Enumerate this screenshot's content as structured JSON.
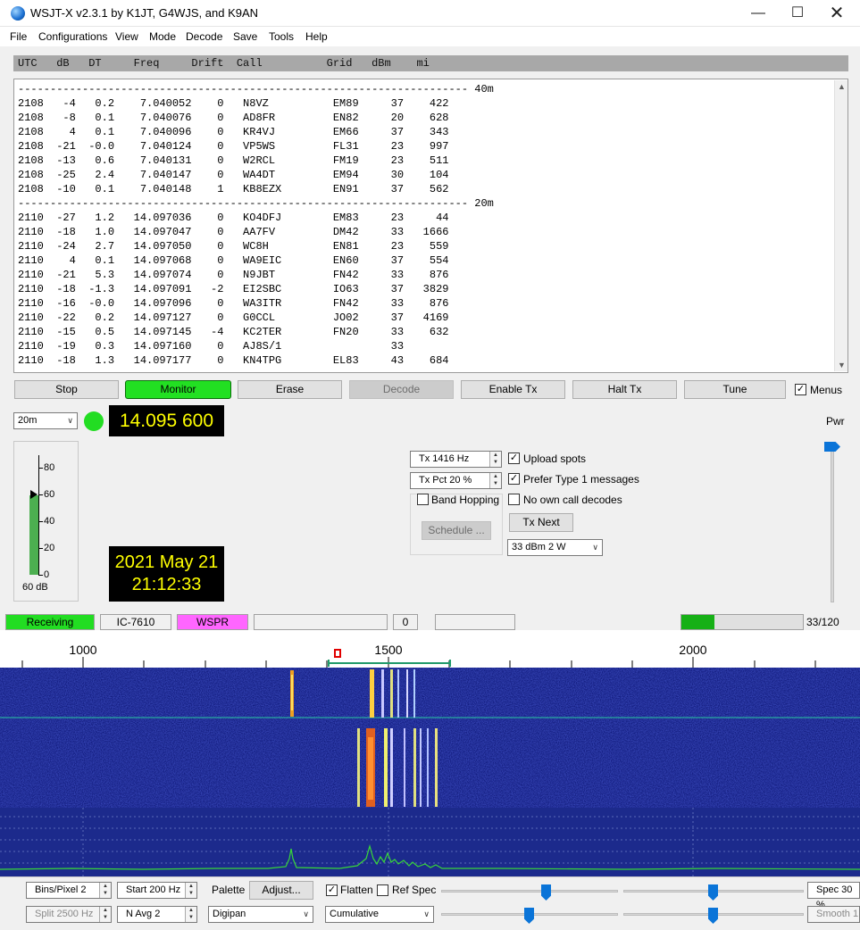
{
  "window": {
    "title": "WSJT-X  v2.3.1   by K1JT, G4WJS, and K9AN"
  },
  "menu": [
    "File",
    "Configurations",
    "View",
    "Mode",
    "Decode",
    "Save",
    "Tools",
    "Help"
  ],
  "table": {
    "header": "UTC   dB   DT     Freq     Drift  Call          Grid   dBm    mi",
    "lines": [
      "---------------------------------------------------------------------- 40m",
      "2108   -4   0.2    7.040052    0   N8VZ          EM89     37    422",
      "2108   -8   0.1    7.040076    0   AD8FR         EN82     20    628",
      "2108    4   0.1    7.040096    0   KR4VJ         EM66     37    343",
      "2108  -21  -0.0    7.040124    0   VP5WS         FL31     23    997",
      "2108  -13   0.6    7.040131    0   W2RCL         FM19     23    511",
      "2108  -25   2.4    7.040147    0   WA4DT         EM94     30    104",
      "2108  -10   0.1    7.040148    1   KB8EZX        EN91     37    562",
      "---------------------------------------------------------------------- 20m",
      "2110  -27   1.2   14.097036    0   KO4DFJ        EM83     23     44",
      "2110  -18   1.0   14.097047    0   AA7FV         DM42     33   1666",
      "2110  -24   2.7   14.097050    0   WC8H          EN81     23    559",
      "2110    4   0.1   14.097068    0   WA9EIC        EN60     37    554",
      "2110  -21   5.3   14.097074    0   N9JBT         FN42     33    876",
      "2110  -18  -1.3   14.097091   -2   EI2SBC        IO63     37   3829",
      "2110  -16  -0.0   14.097096    0   WA3ITR        FN42     33    876",
      "2110  -22   0.2   14.097127    0   G0CCL         JO02     37   4169",
      "2110  -15   0.5   14.097145   -4   KC2TER        FN20     33    632",
      "2110  -19   0.3   14.097160    0   AJ8S/1                 33",
      "2110  -18   1.3   14.097177    0   KN4TPG        EL83     43    684"
    ]
  },
  "buttons": {
    "stop": "Stop",
    "monitor": "Monitor",
    "erase": "Erase",
    "decode": "Decode",
    "enable_tx": "Enable Tx",
    "halt_tx": "Halt Tx",
    "tune": "Tune",
    "menus": "Menus",
    "tx_next": "Tx Next",
    "schedule": "Schedule ..."
  },
  "band": "20m",
  "frequency": "14.095 600",
  "meter": {
    "ticks": [
      "80",
      "60",
      "40",
      "20",
      "0"
    ],
    "label": "60 dB",
    "level_db": 60
  },
  "datetime": {
    "date": "2021 May 21",
    "time": "21:12:33"
  },
  "pwr_label": "Pwr",
  "wspr": {
    "tx_freq": "Tx  1416  Hz",
    "tx_pct": "Tx Pct 20  %",
    "band_hopping": "Band Hopping",
    "upload_spots": "Upload spots",
    "prefer_type1": "Prefer Type 1 messages",
    "no_own_call": "No own call decodes",
    "power": "33 dBm  2 W"
  },
  "status": {
    "receiving": "Receiving",
    "rig": "IC-7610",
    "mode": "WSPR",
    "count": "0",
    "progress_label": "33/120",
    "progress": 0.275
  },
  "waterfall": {
    "scale_labels": [
      "1000",
      "1500",
      "2000"
    ],
    "controls": {
      "bins_pixel": "Bins/Pixel  2",
      "start": "Start 200 Hz",
      "palette_label": "Palette",
      "adjust": "Adjust...",
      "flatten": "Flatten",
      "ref_spec": "Ref Spec",
      "spec": "Spec 30 %",
      "split": "Split  2500  Hz",
      "navg": "N Avg 2",
      "palette": "Digipan",
      "cumulative": "Cumulative",
      "smooth": "Smooth  1"
    }
  },
  "colors": {
    "monitor_green": "#22e022",
    "receiving_green": "#22dd22",
    "wspr_pink": "#ff66ff",
    "freq_yellow": "#ffff00"
  }
}
